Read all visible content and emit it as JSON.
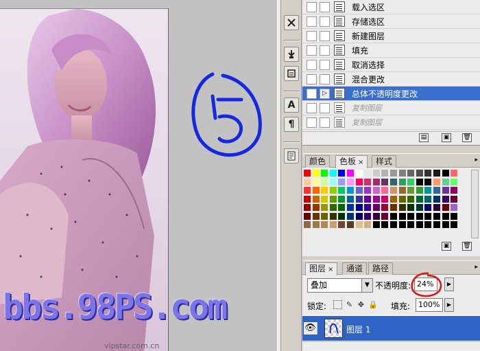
{
  "actions": {
    "items": [
      {
        "label": "载入选区",
        "state": "normal"
      },
      {
        "label": "存储选区",
        "state": "normal"
      },
      {
        "label": "新建图层",
        "state": "normal"
      },
      {
        "label": "填充",
        "state": "normal"
      },
      {
        "label": "取消选择",
        "state": "normal"
      },
      {
        "label": "混合更改",
        "state": "normal"
      },
      {
        "label": "总体不透明度更改",
        "state": "selected"
      },
      {
        "label": "复制图层",
        "state": "muted"
      },
      {
        "label": "复制图层",
        "state": "muted"
      }
    ]
  },
  "tool_strip": {
    "text_tool_glyph": "A",
    "paragraph_glyph": "¶"
  },
  "swatches_panel": {
    "tabs": [
      {
        "label": "颜色",
        "active": false
      },
      {
        "label": "色板",
        "active": true
      },
      {
        "label": "样式",
        "active": false
      }
    ],
    "tab_close": "×",
    "colors": [
      [
        "#ff0000",
        "#ffff00",
        "#00ff00",
        "#00ffff",
        "#0000ff",
        "#ff00ff",
        "#ffffff",
        "#e6e6e6",
        "#cccccc",
        "#b3b3b3",
        "#999999",
        "#808080",
        "#666666",
        "#4d4d4d",
        "#333333",
        "#1a1a1a",
        "#000000",
        "#ff6666"
      ],
      [
        "#ffcc99",
        "#ffff99",
        "#ccff99",
        "#99ffff",
        "#9999ff",
        "#ff99ff",
        "#ff0066",
        "#cc3366",
        "#993366",
        "#663366",
        "#336666",
        "#339966",
        "#33cc66",
        "#000000",
        "#000000",
        "#ff9966",
        "#66cc99",
        "#66ff66"
      ],
      [
        "#ff3333",
        "#ff6600",
        "#ffcc00",
        "#99cc00",
        "#00cc66",
        "#0099cc",
        "#6666cc",
        "#9933cc",
        "#cc66cc",
        "#ff6699",
        "#cc9966",
        "#996633",
        "#669933",
        "#339933",
        "#009999",
        "#336699",
        "#663399",
        "#990066"
      ],
      [
        "#cc0000",
        "#cc6600",
        "#cccc00",
        "#669900",
        "#009933",
        "#006699",
        "#333399",
        "#660099",
        "#990099",
        "#cc0066",
        "#996600",
        "#666600",
        "#336600",
        "#006633",
        "#006666",
        "#003366",
        "#330066",
        "#660033"
      ],
      [
        "#990000",
        "#993300",
        "#999900",
        "#336600",
        "#006600",
        "#003399",
        "#000099",
        "#330099",
        "#660066",
        "#990033",
        "#663300",
        "#333300",
        "#003300",
        "#003333",
        "#000066",
        "#330033",
        "#660000",
        "#9966cc"
      ],
      [
        "#660000",
        "#663300",
        "#666600",
        "#333300",
        "#003300",
        "#003366",
        "#000066",
        "#330066",
        "#330033",
        "#660033",
        "#000000",
        "#000000",
        "#000000",
        "#000000",
        "#000000",
        "#000000",
        "#000000",
        "#000000"
      ],
      [
        "#8c6a4a",
        "#a07850",
        "#b08a5a",
        "#c8a070",
        "#704830",
        "#5a3a20",
        "#e0c090",
        "#d4b07a",
        "#000000",
        "#000000",
        "#000000",
        "#000000",
        "#000000",
        "#000000",
        "#000000",
        "#000000",
        "#000000",
        "#000000"
      ]
    ]
  },
  "layers_panel": {
    "tabs": [
      {
        "label": "图层",
        "active": true
      },
      {
        "label": "通道",
        "active": false
      },
      {
        "label": "路径",
        "active": false
      }
    ],
    "tab_close": "×",
    "blend_mode": "叠加",
    "opacity_label": "不透明度:",
    "opacity_value": "24%",
    "lock_label": "锁定:",
    "fill_label": "填充:",
    "fill_value": "100%",
    "layer_name": "图层 1",
    "accent": "#2f63c4"
  },
  "canvas": {
    "watermark": "bbs.98PS.com",
    "site_credit": "vipstar.com.cn"
  }
}
